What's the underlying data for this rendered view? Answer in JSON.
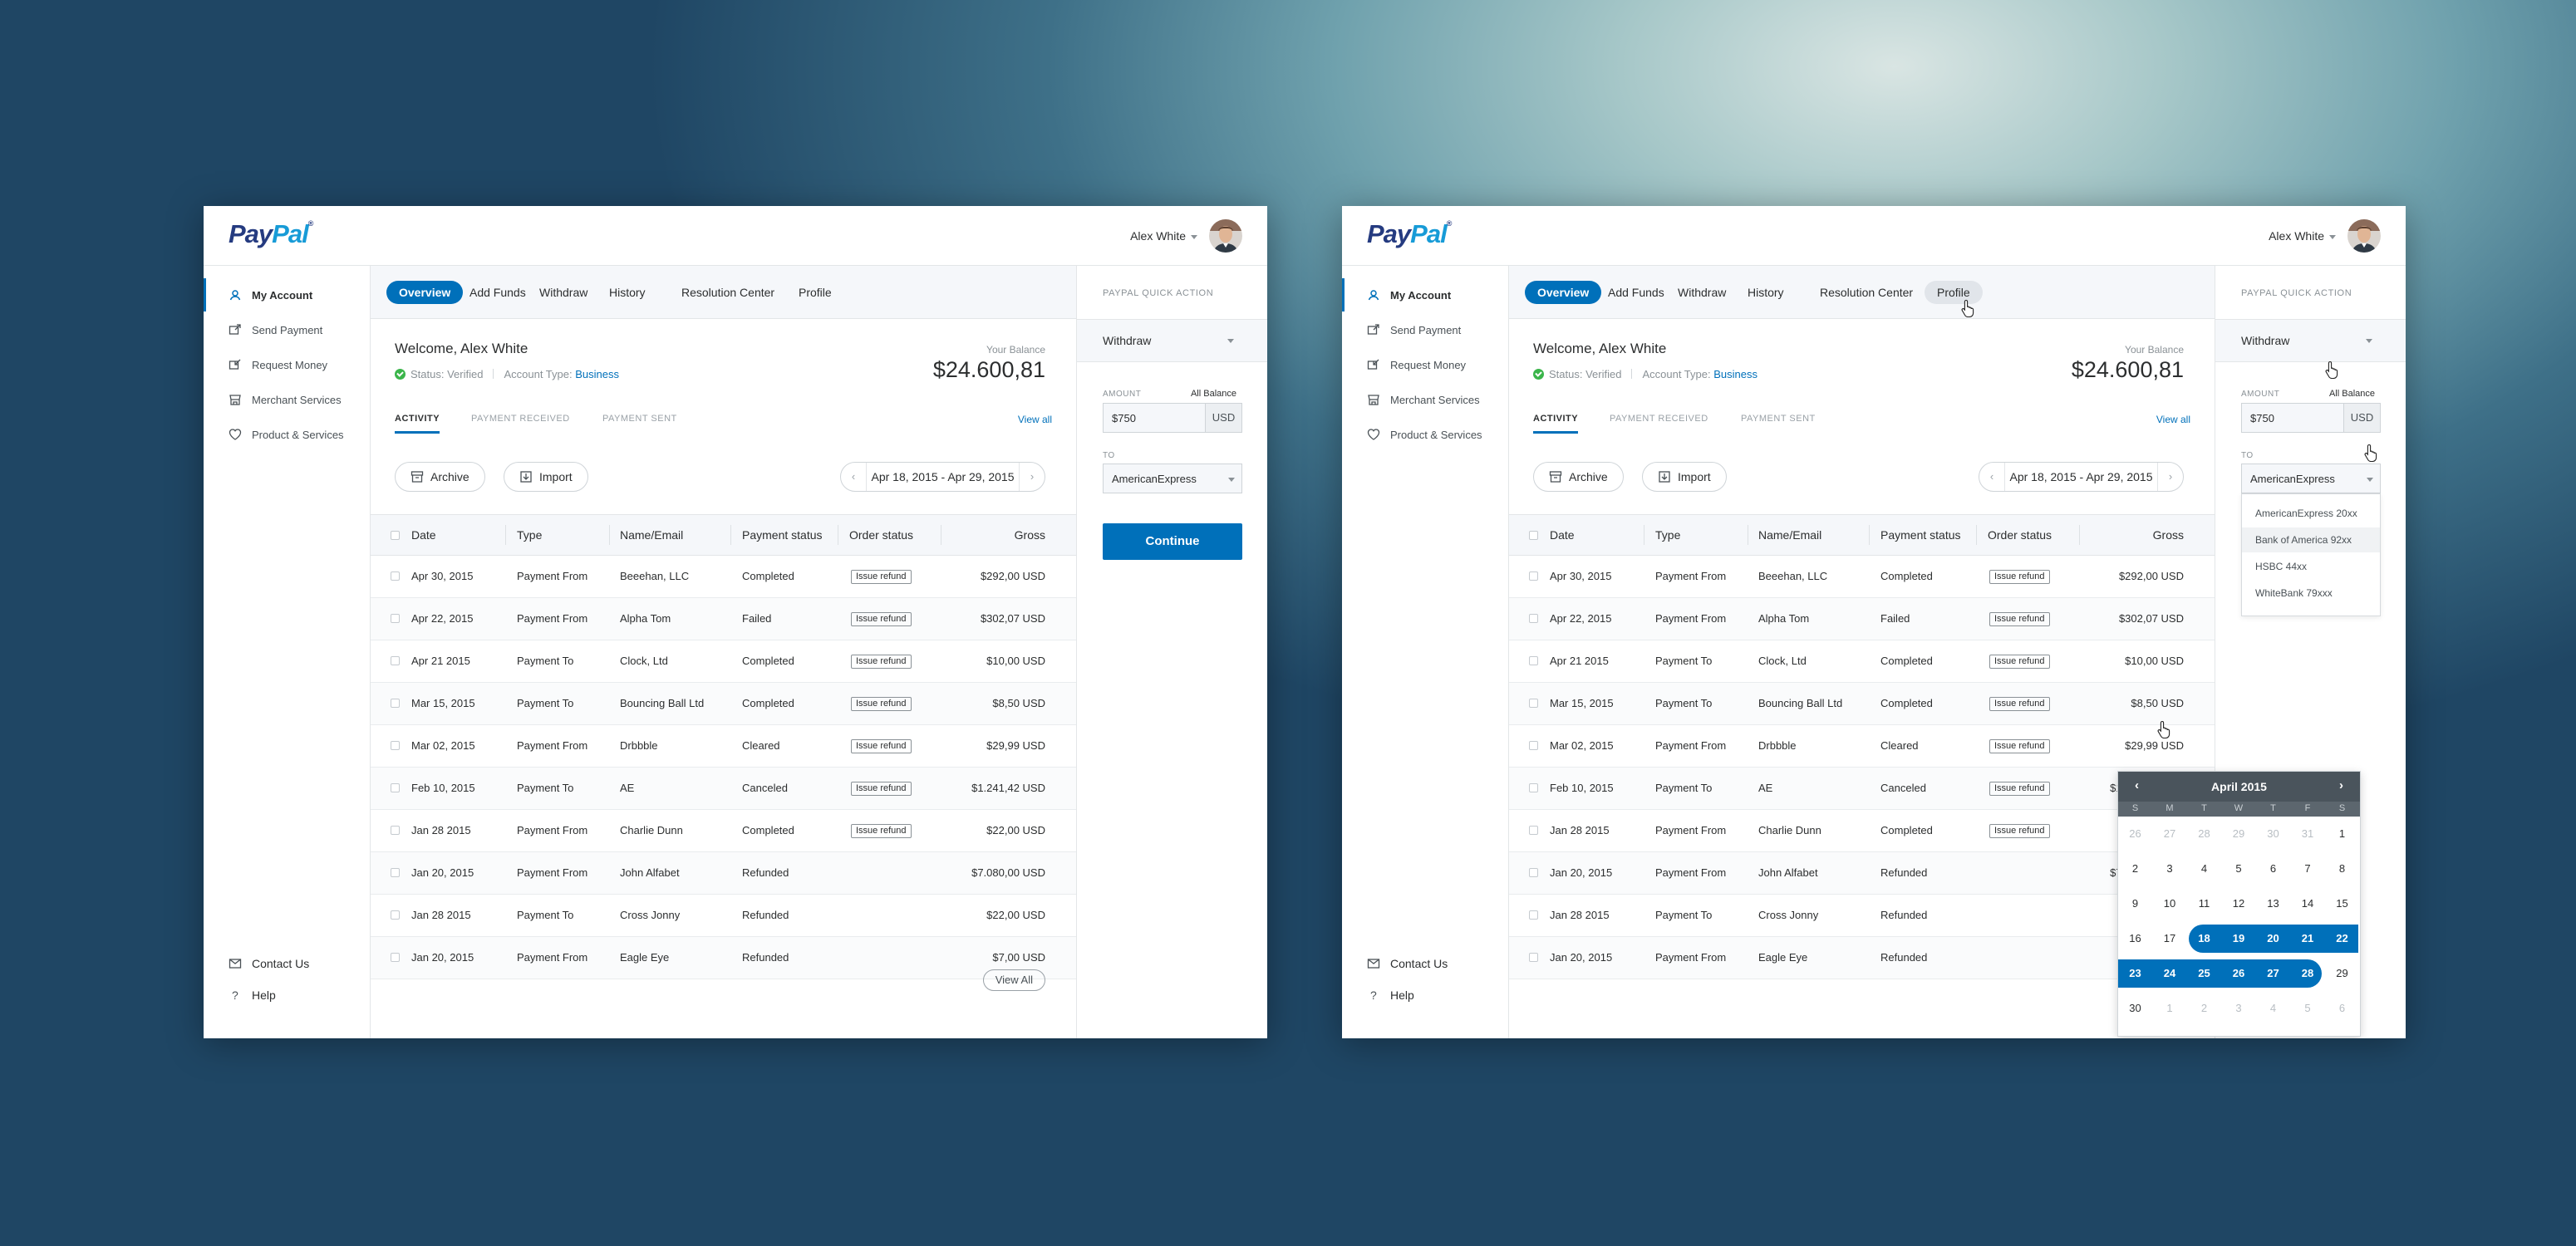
{
  "brand": {
    "pay": "Pay",
    "pal": "Pal",
    "tm": "®"
  },
  "user": {
    "name": "Alex White"
  },
  "sidebar": {
    "items": [
      {
        "label": "My Account",
        "icon": "user-icon"
      },
      {
        "label": "Send Payment",
        "icon": "send-icon"
      },
      {
        "label": "Request Money",
        "icon": "request-icon"
      },
      {
        "label": "Merchant Services",
        "icon": "store-icon"
      },
      {
        "label": "Product & Services",
        "icon": "heart-icon"
      }
    ],
    "footer": [
      {
        "label": "Contact Us",
        "icon": "mail-icon"
      },
      {
        "label": "Help",
        "icon": "question-icon"
      }
    ]
  },
  "nav": {
    "tabs": [
      "Overview",
      "Add Funds",
      "Withdraw",
      "History",
      "Resolution Center",
      "Profile"
    ]
  },
  "account": {
    "welcome": "Welcome, Alex White",
    "status": "Status: Verified",
    "account_type_label": "Account Type:",
    "account_type": "Business",
    "balance_label": "Your Balance",
    "balance": "$24.600,81"
  },
  "activity": {
    "tabs": [
      "ACTIVITY",
      "PAYMENT RECEIVED",
      "PAYMENT SENT"
    ],
    "view_all": "View all",
    "archive": "Archive",
    "import": "Import",
    "date_range": "Apr 18, 2015 - Apr 29, 2015",
    "footer_button": "View All"
  },
  "table": {
    "columns": [
      "Date",
      "Type",
      "Name/Email",
      "Payment status",
      "Order status",
      "Gross"
    ],
    "rows": [
      {
        "date": "Apr 30, 2015",
        "type": "Payment From",
        "name": "Beeehan, LLC",
        "status": "Completed",
        "order": "Issue refund",
        "gross": "$292,00 USD"
      },
      {
        "date": "Apr 22, 2015",
        "type": "Payment From",
        "name": "Alpha Tom",
        "status": "Failed",
        "order": "Issue refund",
        "gross": "$302,07 USD"
      },
      {
        "date": "Apr 21 2015",
        "type": "Payment To",
        "name": "Clock, Ltd",
        "status": "Completed",
        "order": "Issue refund",
        "gross": "$10,00 USD"
      },
      {
        "date": "Mar 15, 2015",
        "type": "Payment To",
        "name": "Bouncing Ball Ltd",
        "status": "Completed",
        "order": "Issue refund",
        "gross": "$8,50 USD"
      },
      {
        "date": "Mar 02, 2015",
        "type": "Payment From",
        "name": "Drbbble",
        "status": "Cleared",
        "order": "Issue refund",
        "gross": "$29,99 USD"
      },
      {
        "date": "Feb 10, 2015",
        "type": "Payment To",
        "name": "AE",
        "status": "Canceled",
        "order": "Issue refund",
        "gross": "$1.241,42 USD"
      },
      {
        "date": "Jan 28 2015",
        "type": "Payment From",
        "name": "Charlie Dunn",
        "status": "Completed",
        "order": "Issue refund",
        "gross": "$22,00 USD"
      },
      {
        "date": "Jan 20, 2015",
        "type": "Payment From",
        "name": "John Alfabet",
        "status": "Refunded",
        "order": "",
        "gross": "$7.080,00 USD"
      },
      {
        "date": "Jan 28 2015",
        "type": "Payment To",
        "name": "Cross Jonny",
        "status": "Refunded",
        "order": "",
        "gross": "$22,00 USD"
      },
      {
        "date": "Jan 20, 2015",
        "type": "Payment From",
        "name": "Eagle Eye",
        "status": "Refunded",
        "order": "",
        "gross": "$7,00 USD"
      }
    ]
  },
  "quick_action": {
    "title": "PAYPAL QUICK ACTION",
    "action": "Withdraw",
    "amount_label": "AMOUNT",
    "all_balance": "All Balance",
    "amount": "$750",
    "currency": "USD",
    "to_label": "TO",
    "to": "AmericanExpress",
    "continue": "Continue",
    "to_options": [
      "AmericanExpress 20xx",
      "Bank of America 92xx",
      "HSBC  44xx",
      "WhiteBank 79xxx"
    ]
  },
  "calendar": {
    "month": "April 2015",
    "prev": "‹",
    "next": "›",
    "dow": [
      "S",
      "M",
      "T",
      "W",
      "T",
      "F",
      "S"
    ],
    "weeks": [
      [
        "26",
        "27",
        "28",
        "29",
        "30",
        "31",
        "1"
      ],
      [
        "2",
        "3",
        "4",
        "5",
        "6",
        "7",
        "8"
      ],
      [
        "9",
        "10",
        "11",
        "12",
        "13",
        "14",
        "15"
      ],
      [
        "16",
        "17",
        "18",
        "19",
        "20",
        "21",
        "22"
      ],
      [
        "23",
        "24",
        "25",
        "26",
        "27",
        "28",
        "29"
      ],
      [
        "30",
        "1",
        "2",
        "3",
        "4",
        "5",
        "6"
      ]
    ],
    "selected_start": "18",
    "selected_end": "28"
  },
  "colors": {
    "accent": "#0070ba",
    "paypal_dark": "#253b80",
    "paypal_light": "#179bd7",
    "verified": "#3ab54a"
  }
}
